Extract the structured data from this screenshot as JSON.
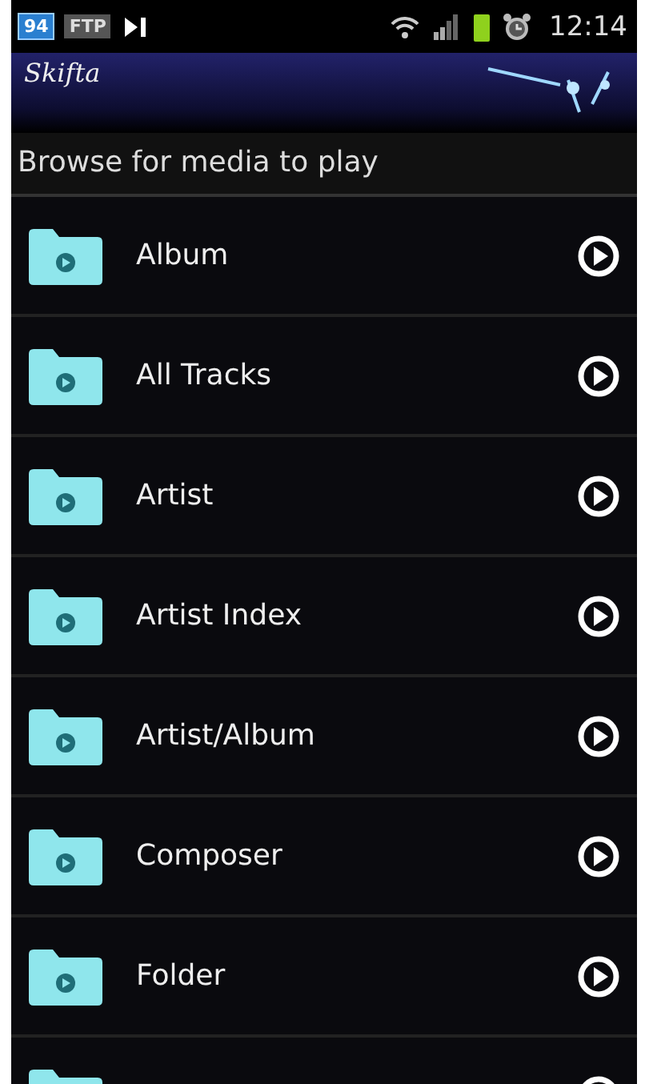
{
  "status_bar": {
    "badges": [
      "94",
      "FTP"
    ],
    "time": "12:14"
  },
  "header": {
    "logo": "Skifta"
  },
  "title": "Browse for media to play",
  "items": [
    {
      "kind": "entry",
      "label": "Album"
    },
    {
      "kind": "entry",
      "label": "All Tracks"
    },
    {
      "kind": "entry",
      "label": "Artist"
    },
    {
      "kind": "entry",
      "label": "Artist Index"
    },
    {
      "kind": "entry",
      "label": "Artist/Album"
    },
    {
      "kind": "entry",
      "label": "Composer"
    },
    {
      "kind": "entry",
      "label": "Folder"
    },
    {
      "kind": "cut_off"
    }
  ]
}
